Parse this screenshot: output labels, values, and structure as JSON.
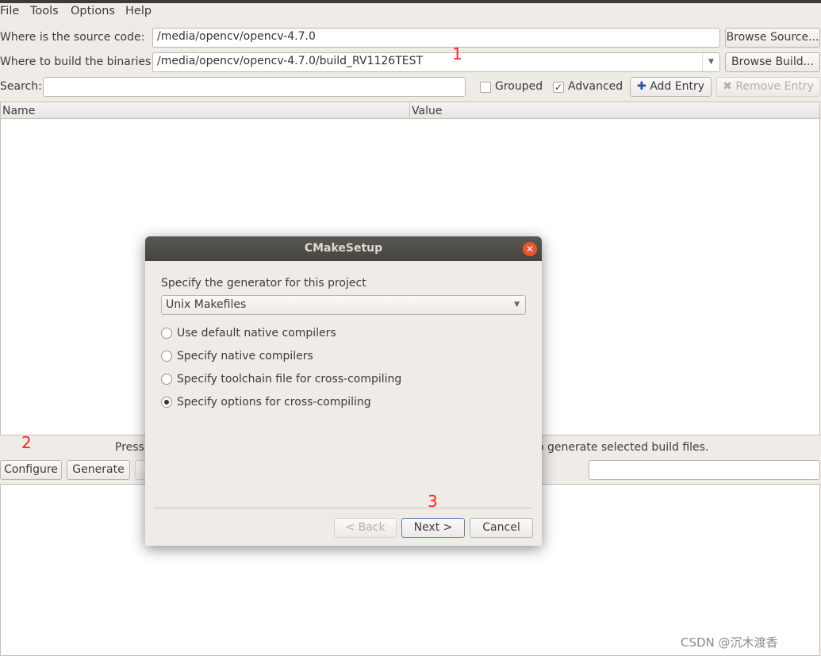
{
  "menu": [
    "File",
    "Tools",
    "Options",
    "Help"
  ],
  "source": {
    "label": "Where is the source code:",
    "value": "/media/opencv/opencv-4.7.0",
    "button": "Browse Source..."
  },
  "build": {
    "label": "Where to build the binaries:",
    "value": "/media/opencv/opencv-4.7.0/build_RV1126TEST",
    "button": "Browse Build..."
  },
  "search": {
    "label": "Search:",
    "value": ""
  },
  "grouped": {
    "label": "Grouped",
    "checked": false
  },
  "advanced": {
    "label": "Advanced",
    "checked": true,
    "mark": "✓"
  },
  "add_entry": "Add Entry",
  "remove_entry": "Remove Entry",
  "table": {
    "columns": [
      "Name",
      "Value"
    ]
  },
  "status": {
    "left": "Press",
    "right": "o generate selected build files."
  },
  "buttons": {
    "configure": "Configure",
    "generate": "Generate"
  },
  "annotations": [
    "1",
    "2",
    "3"
  ],
  "dialog": {
    "title": "CMakeSetup",
    "prompt": "Specify the generator for this project",
    "generator": "Unix Makefiles",
    "options": [
      {
        "label": "Use default native compilers",
        "selected": false
      },
      {
        "label": "Specify native compilers",
        "selected": false
      },
      {
        "label": "Specify toolchain file for cross-compiling",
        "selected": false
      },
      {
        "label": "Specify options for cross-compiling",
        "selected": true
      }
    ],
    "back": "< Back",
    "next": "Next >",
    "cancel": "Cancel"
  },
  "watermark": "CSDN @沉木渡香"
}
